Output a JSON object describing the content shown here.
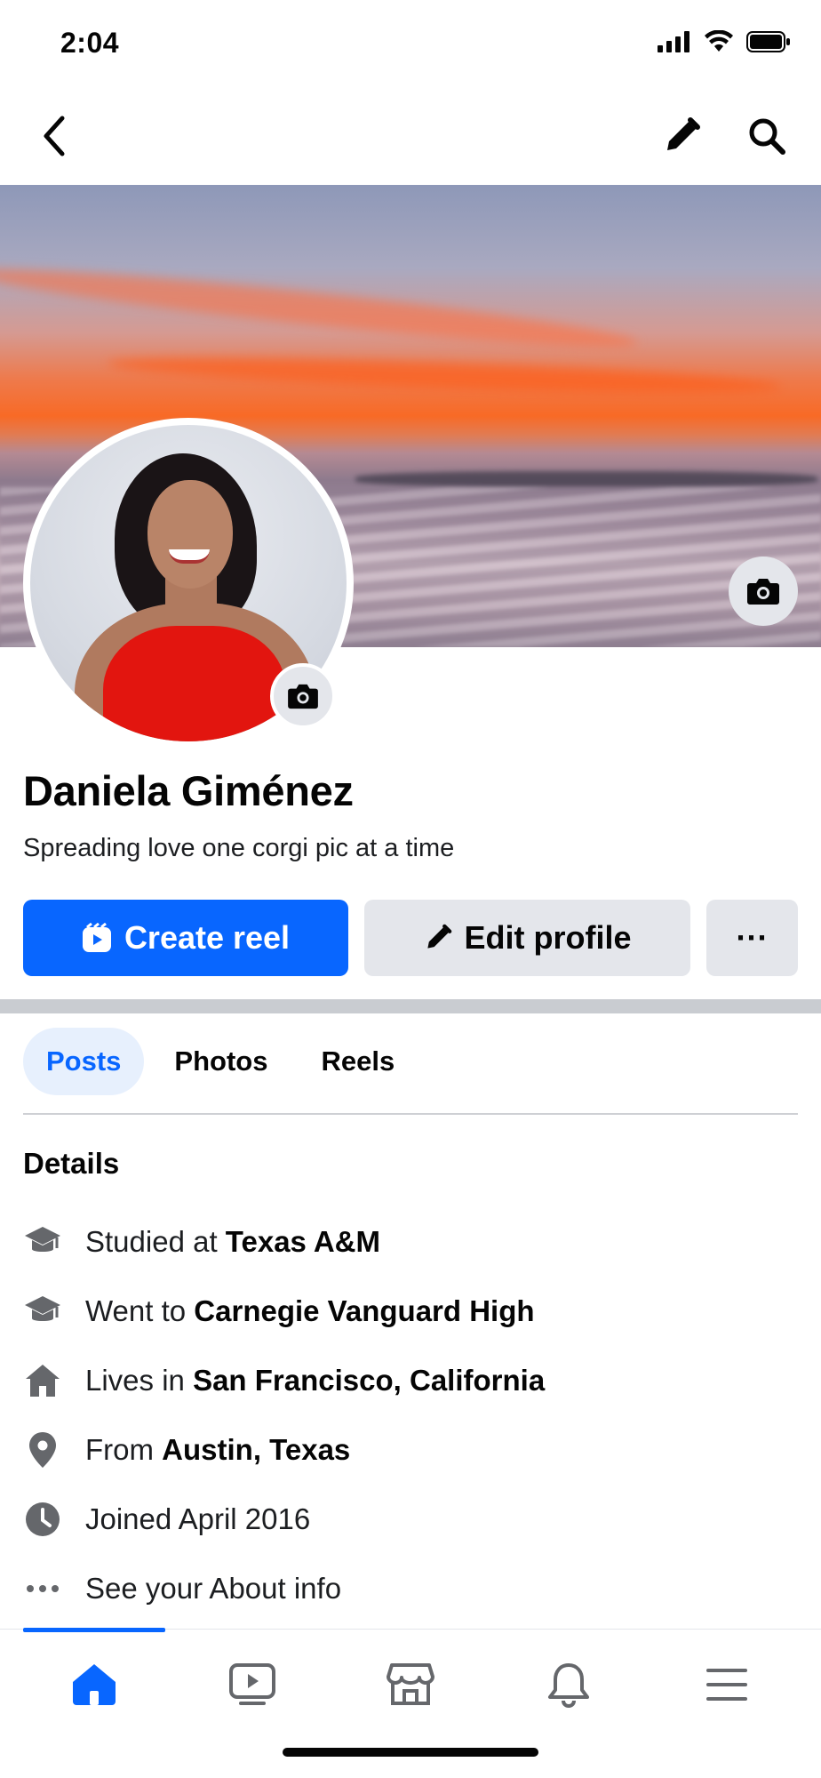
{
  "status_bar": {
    "time": "2:04"
  },
  "top_nav": {
    "back_icon": "chevron-left-icon",
    "edit_icon": "pencil-icon",
    "search_icon": "search-icon"
  },
  "profile": {
    "name": "Daniela Giménez",
    "bio": "Spreading love one corgi pic at a time"
  },
  "actions": {
    "create_reel_label": "Create reel",
    "edit_profile_label": "Edit profile",
    "more_label": "···"
  },
  "tabs": [
    {
      "label": "Posts",
      "active": true
    },
    {
      "label": "Photos",
      "active": false
    },
    {
      "label": "Reels",
      "active": false
    }
  ],
  "details": {
    "title": "Details",
    "items": [
      {
        "icon": "graduation-cap-icon",
        "prefix": "Studied at ",
        "value": "Texas A&M"
      },
      {
        "icon": "graduation-cap-icon",
        "prefix": "Went to ",
        "value": "Carnegie Vanguard High"
      },
      {
        "icon": "home-icon",
        "prefix": "Lives in ",
        "value": "San Francisco, California"
      },
      {
        "icon": "location-pin-icon",
        "prefix": "From ",
        "value": "Austin, Texas"
      },
      {
        "icon": "clock-icon",
        "prefix": "Joined April 2016",
        "value": ""
      },
      {
        "icon": "more-dots-icon",
        "prefix": "See your About info",
        "value": ""
      }
    ]
  },
  "bottom_nav": {
    "items": [
      {
        "icon": "home-icon",
        "active": true
      },
      {
        "icon": "video-icon",
        "active": false
      },
      {
        "icon": "marketplace-icon",
        "active": false
      },
      {
        "icon": "bell-icon",
        "active": false
      },
      {
        "icon": "menu-icon",
        "active": false
      }
    ]
  },
  "colors": {
    "primary": "#0866ff",
    "secondary_bg": "#e4e6eb",
    "tab_active_bg": "#e7f0fd",
    "text": "#050505",
    "icon_gray": "#65676b"
  }
}
